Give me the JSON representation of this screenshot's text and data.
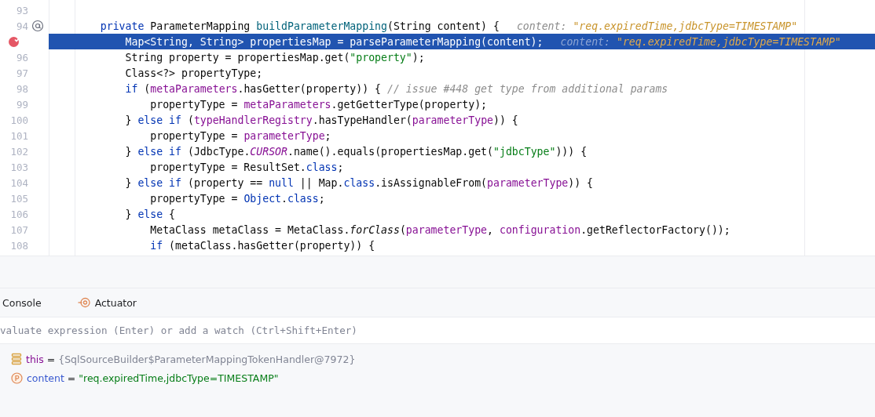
{
  "editor": {
    "lines": [
      {
        "number": "93"
      },
      {
        "number": "94",
        "gutter_marker": true,
        "tokens": [
          {
            "kind": "kw",
            "text": "    private "
          },
          {
            "kind": "plain",
            "text": "ParameterMapping "
          },
          {
            "kind": "decl",
            "text": "buildParameterMapping"
          },
          {
            "kind": "plain",
            "text": "(String content) {"
          }
        ],
        "hint": {
          "label": "content: ",
          "value": "\"req.expiredTime,jdbcType=TIMESTAMP\""
        }
      },
      {
        "breakpoint": true,
        "highlighted": true,
        "tokens": [
          {
            "kind": "plain",
            "text": "        Map<String, String> propertiesMap = parseParameterMapping(content);"
          }
        ],
        "hint": {
          "label": "content: ",
          "value": "\"req.expiredTime,jdbcType=TIMESTAMP\""
        }
      },
      {
        "number": "96",
        "tokens": [
          {
            "kind": "plain",
            "text": "        String property = propertiesMap.get("
          },
          {
            "kind": "str",
            "text": "\"property\""
          },
          {
            "kind": "plain",
            "text": ");"
          }
        ]
      },
      {
        "number": "97",
        "tokens": [
          {
            "kind": "plain",
            "text": "        Class<?> propertyType;"
          }
        ]
      },
      {
        "number": "98",
        "tokens": [
          {
            "kind": "kw",
            "text": "        if "
          },
          {
            "kind": "plain",
            "text": "("
          },
          {
            "kind": "field",
            "text": "metaParameters"
          },
          {
            "kind": "plain",
            "text": ".hasGetter(property)) { "
          },
          {
            "kind": "comment",
            "text": "// issue #448 get type from additional params"
          }
        ]
      },
      {
        "number": "99",
        "tokens": [
          {
            "kind": "plain",
            "text": "            propertyType = "
          },
          {
            "kind": "field",
            "text": "metaParameters"
          },
          {
            "kind": "plain",
            "text": ".getGetterType(property);"
          }
        ]
      },
      {
        "number": "100",
        "tokens": [
          {
            "kind": "plain",
            "text": "        } "
          },
          {
            "kind": "kw",
            "text": "else if "
          },
          {
            "kind": "plain",
            "text": "("
          },
          {
            "kind": "field",
            "text": "typeHandlerRegistry"
          },
          {
            "kind": "plain",
            "text": ".hasTypeHandler("
          },
          {
            "kind": "field",
            "text": "parameterType"
          },
          {
            "kind": "plain",
            "text": ")) {"
          }
        ]
      },
      {
        "number": "101",
        "tokens": [
          {
            "kind": "plain",
            "text": "            propertyType = "
          },
          {
            "kind": "field",
            "text": "parameterType"
          },
          {
            "kind": "plain",
            "text": ";"
          }
        ]
      },
      {
        "number": "102",
        "tokens": [
          {
            "kind": "plain",
            "text": "        } "
          },
          {
            "kind": "kw",
            "text": "else if "
          },
          {
            "kind": "plain",
            "text": "(JdbcType."
          },
          {
            "kind": "static",
            "text": "CURSOR"
          },
          {
            "kind": "plain",
            "text": ".name().equals(propertiesMap.get("
          },
          {
            "kind": "str",
            "text": "\"jdbcType\""
          },
          {
            "kind": "plain",
            "text": "))) {"
          }
        ]
      },
      {
        "number": "103",
        "tokens": [
          {
            "kind": "plain",
            "text": "            propertyType = ResultSet."
          },
          {
            "kind": "kw",
            "text": "class"
          },
          {
            "kind": "plain",
            "text": ";"
          }
        ]
      },
      {
        "number": "104",
        "tokens": [
          {
            "kind": "plain",
            "text": "        } "
          },
          {
            "kind": "kw",
            "text": "else if "
          },
          {
            "kind": "plain",
            "text": "(property == "
          },
          {
            "kind": "kw",
            "text": "null "
          },
          {
            "kind": "plain",
            "text": "|| Map."
          },
          {
            "kind": "kw",
            "text": "class"
          },
          {
            "kind": "plain",
            "text": ".isAssignableFrom("
          },
          {
            "kind": "field",
            "text": "parameterType"
          },
          {
            "kind": "plain",
            "text": ")) {"
          }
        ]
      },
      {
        "number": "105",
        "tokens": [
          {
            "kind": "plain",
            "text": "            propertyType = "
          },
          {
            "kind": "kw",
            "text": "Object"
          },
          {
            "kind": "plain",
            "text": "."
          },
          {
            "kind": "kw",
            "text": "class"
          },
          {
            "kind": "plain",
            "text": ";"
          }
        ]
      },
      {
        "number": "106",
        "tokens": [
          {
            "kind": "plain",
            "text": "        } "
          },
          {
            "kind": "kw",
            "text": "else "
          },
          {
            "kind": "plain",
            "text": "{"
          }
        ]
      },
      {
        "number": "107",
        "tokens": [
          {
            "kind": "plain",
            "text": "            MetaClass metaClass = MetaClass."
          },
          {
            "kind": "staticcall",
            "text": "forClass"
          },
          {
            "kind": "plain",
            "text": "("
          },
          {
            "kind": "field",
            "text": "parameterType"
          },
          {
            "kind": "plain",
            "text": ", "
          },
          {
            "kind": "field",
            "text": "configuration"
          },
          {
            "kind": "plain",
            "text": ".getReflectorFactory());"
          }
        ]
      },
      {
        "number": "108",
        "tokens": [
          {
            "kind": "kw",
            "text": "            if "
          },
          {
            "kind": "plain",
            "text": "(metaClass.hasGetter(property)) {"
          }
        ]
      }
    ]
  },
  "debug_tabs": [
    {
      "label": "Console"
    },
    {
      "label": "Actuator"
    }
  ],
  "evaluate": {
    "placeholder": "valuate expression (Enter) or add a watch (Ctrl+Shift+Enter)"
  },
  "variables": [
    {
      "kind": "object",
      "name": "this",
      "equals": " = ",
      "value": "{SqlSourceBuilder$ParameterMappingTokenHandler@7972}"
    },
    {
      "kind": "param",
      "name": "content",
      "equals": " = ",
      "value": "\"req.expiredTime,jdbcType=TIMESTAMP\""
    }
  ]
}
